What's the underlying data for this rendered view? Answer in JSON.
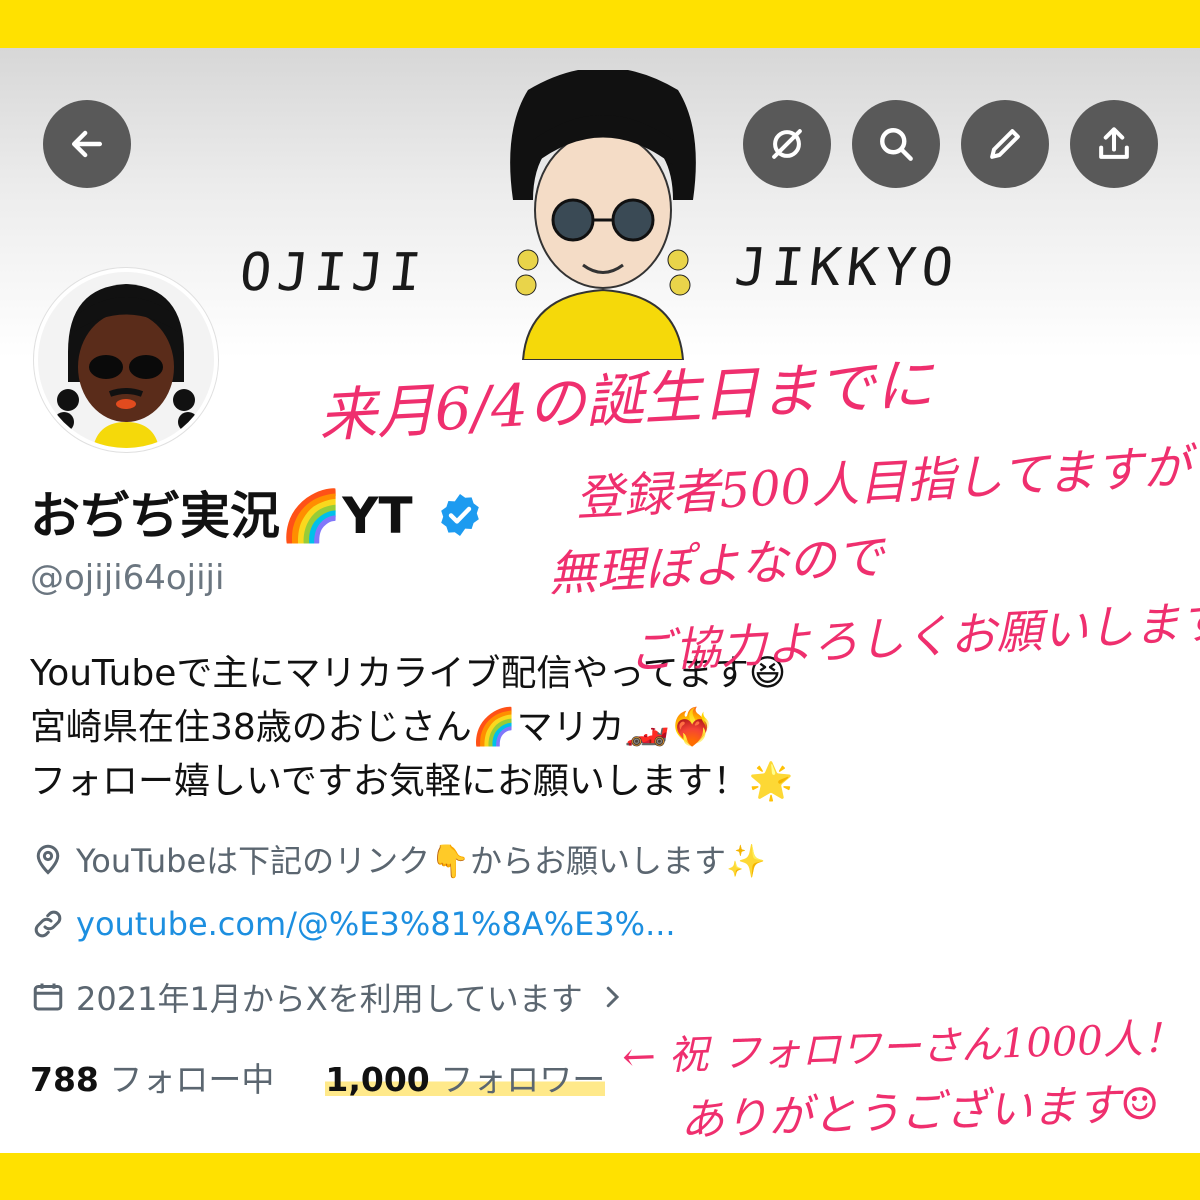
{
  "header": {
    "logo_left": "OJIJI",
    "logo_right": "JIKKYO",
    "buttons": [
      "back-icon",
      "hidden-eye-icon",
      "search-icon",
      "edit-pencil-icon",
      "share-icon"
    ]
  },
  "profile": {
    "name": "おぢぢ実況🌈YT",
    "handle": "@ojiji64ojiji",
    "bio_lines": [
      "YouTubeで主にマリカライブ配信やってます😆",
      "宮崎県在住38歳のおじさん🌈マリカ🏎️❤️‍🔥",
      "フォロー嬉しいですお気軽にお願いします！🌟"
    ],
    "location": "YouTubeは下記のリンク👇からお願いします✨",
    "url": "youtube.com/@%E3%81%8A%E3%...",
    "joined": "2021年1月からXを利用しています",
    "following_count": "788",
    "following_label": "フォロー中",
    "followers_count": "1,000",
    "followers_label": "フォロワー"
  },
  "annotations": {
    "top": [
      "来月6/4の誕生日までに",
      "登録者500人目指してますが",
      "無理ぽよなので",
      "ご協力よろしくお願いします！🙏"
    ],
    "bottom": [
      "← 祝 フォロワーさん1000人！",
      "ありがとうございます☺"
    ]
  },
  "colors": {
    "frame": "#ffe100",
    "handwriting": "#ef2f6e",
    "link": "#1d8fe0",
    "verified": "#1d9bf0"
  }
}
